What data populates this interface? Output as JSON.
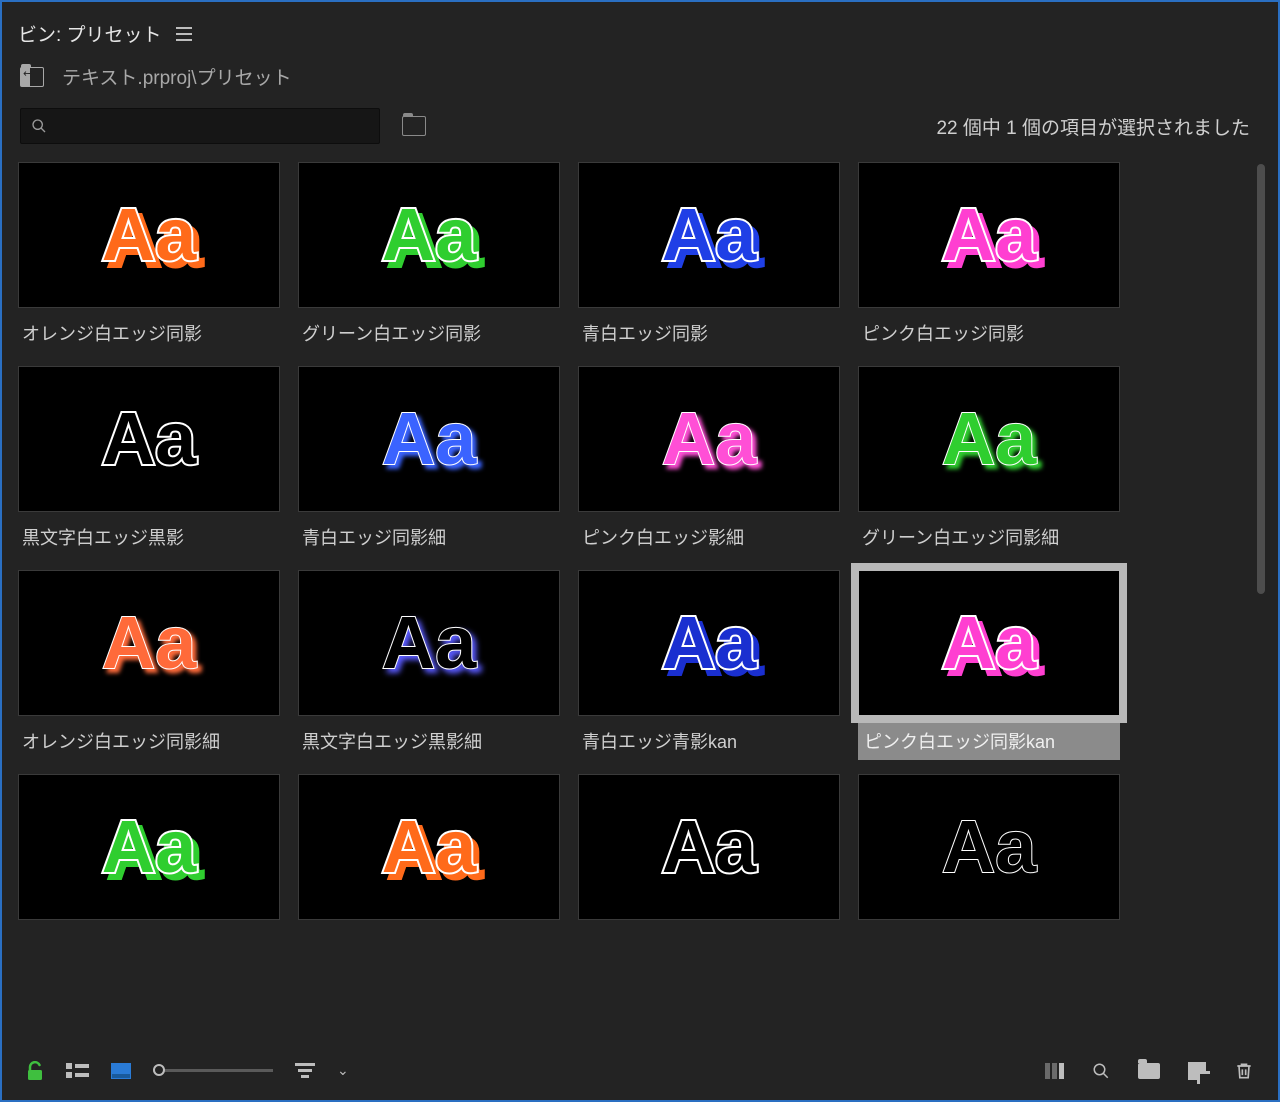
{
  "header": {
    "title": "ビン: プリセット",
    "breadcrumb": "テキスト.prproj\\プリセット",
    "search_placeholder": "",
    "selection_status": "22 個中 1 個の項目が選択されました"
  },
  "presets": [
    {
      "label": "オレンジ白エッジ同影",
      "fill": "#ff6a1a",
      "stroke": "#ffffff",
      "shadow": "#ff6a1a",
      "stroke_w": 4,
      "sx": 6,
      "sy": 6,
      "blur": 0
    },
    {
      "label": "グリーン白エッジ同影",
      "fill": "#2fce2f",
      "stroke": "#ffffff",
      "shadow": "#2fce2f",
      "stroke_w": 4,
      "sx": 6,
      "sy": 6,
      "blur": 0
    },
    {
      "label": "青白エッジ同影",
      "fill": "#1f3fe6",
      "stroke": "#ffffff",
      "shadow": "#1f3fe6",
      "stroke_w": 4,
      "sx": 6,
      "sy": 6,
      "blur": 0
    },
    {
      "label": "ピンク白エッジ同影",
      "fill": "#ff3fd1",
      "stroke": "#ffffff",
      "shadow": "#ff3fd1",
      "stroke_w": 4,
      "sx": 6,
      "sy": 6,
      "blur": 0
    },
    {
      "label": "黒文字白エッジ黒影",
      "fill": "#000000",
      "stroke": "#ffffff",
      "shadow": "#000000",
      "stroke_w": 4,
      "sx": 5,
      "sy": 5,
      "blur": 0
    },
    {
      "label": "青白エッジ同影細",
      "fill": "#3a63ff",
      "stroke": "#ffffff",
      "shadow": "#3a63ff",
      "stroke_w": 2,
      "sx": 4,
      "sy": 4,
      "blur": 2
    },
    {
      "label": "ピンク白エッジ影細",
      "fill": "#ff4fd6",
      "stroke": "#ffffff",
      "shadow": "#ff4fd6",
      "stroke_w": 2,
      "sx": 4,
      "sy": 4,
      "blur": 2
    },
    {
      "label": "グリーン白エッジ同影細",
      "fill": "#2fce2f",
      "stroke": "#ffffff",
      "shadow": "#2fce2f",
      "stroke_w": 2,
      "sx": 4,
      "sy": 4,
      "blur": 2
    },
    {
      "label": "オレンジ白エッジ同影細",
      "fill": "#ff6a3a",
      "stroke": "#ffffff",
      "shadow": "#ff6a3a",
      "stroke_w": 2,
      "sx": 4,
      "sy": 4,
      "blur": 2
    },
    {
      "label": "黒文字白エッジ黒影細",
      "fill": "#000000",
      "stroke": "#ffffff",
      "shadow": "#5a5aff",
      "stroke_w": 2,
      "sx": 4,
      "sy": 4,
      "blur": 3
    },
    {
      "label": "青白エッジ青影kan",
      "fill": "#1a2fd0",
      "stroke": "#ffffff",
      "shadow": "#1a2fd0",
      "stroke_w": 4,
      "sx": 6,
      "sy": 6,
      "blur": 0
    },
    {
      "label": "ピンク白エッジ同影kan",
      "fill": "#ff3fd1",
      "stroke": "#ffffff",
      "shadow": "#ff3fd1",
      "stroke_w": 4,
      "sx": 6,
      "sy": 6,
      "blur": 0,
      "selected": true
    },
    {
      "label": "",
      "fill": "#2fce2f",
      "stroke": "#ffffff",
      "shadow": "#2fce2f",
      "stroke_w": 4,
      "sx": 6,
      "sy": 6,
      "blur": 0
    },
    {
      "label": "",
      "fill": "#ff6a1a",
      "stroke": "#ffffff",
      "shadow": "#ff6a1a",
      "stroke_w": 4,
      "sx": 6,
      "sy": 6,
      "blur": 0
    },
    {
      "label": "",
      "fill": "#000000",
      "stroke": "#ffffff",
      "shadow": "#000000",
      "stroke_w": 4,
      "sx": 5,
      "sy": 5,
      "blur": 0
    },
    {
      "label": "",
      "fill": "#000000",
      "stroke": "#ffffff",
      "shadow": "#000000",
      "stroke_w": 2,
      "sx": 3,
      "sy": 3,
      "blur": 2
    }
  ],
  "footer": {
    "lock": "open",
    "view_mode": "icon",
    "zoom": 0
  }
}
